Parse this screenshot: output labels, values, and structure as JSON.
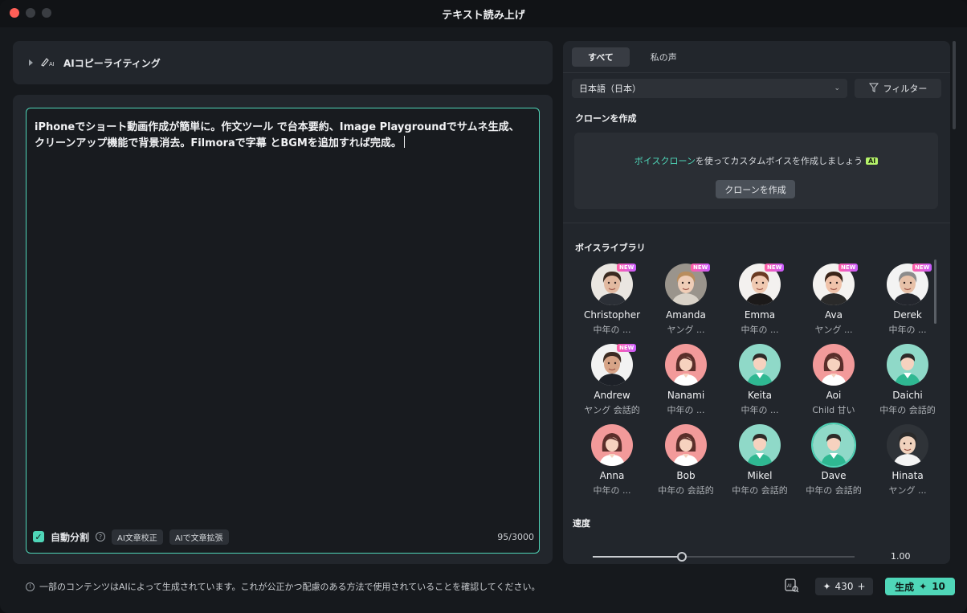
{
  "window": {
    "title": "テキスト読み上げ"
  },
  "copywriting": {
    "label": "AIコピーライティング"
  },
  "editor": {
    "text": "iPhoneでショート動画作成が簡単に。作文ツール で台本要約、Image Playgroundでサムネ生成、 クリーンアップ機能で背景消去。Filmoraで字幕 とBGMを追加すれば完成。",
    "auto_split_label": "自動分割",
    "auto_split_checked": true,
    "chip_proofread": "AI文章校正",
    "chip_expand": "AIで文章拡張",
    "counter": "95/3000"
  },
  "disclaimer": "一部のコンテンツはAIによって生成されています。これが公正かつ配慮のある方法で使用されていることを確認してください。",
  "right_panel": {
    "tabs": [
      {
        "label": "すべて",
        "active": true
      },
      {
        "label": "私の声",
        "active": false
      }
    ],
    "language": "日本語（日本）",
    "filter_label": "フィルター",
    "clone_section_title": "クローンを作成",
    "clone_link": "ボイスクローン",
    "clone_text": "を使ってカスタムボイスを作成しましょう",
    "ai_badge": "AI",
    "clone_button": "クローンを作成",
    "library_title": "ボイスライブラリ",
    "new_badge": "NEW",
    "voices": [
      {
        "name": "Christopher",
        "desc": "中年の ...",
        "new": true,
        "avatar": "photo-male-beard"
      },
      {
        "name": "Amanda",
        "desc": "ヤング ...",
        "new": true,
        "avatar": "photo-female-blonde"
      },
      {
        "name": "Emma",
        "desc": "中年の ...",
        "new": true,
        "avatar": "photo-female-brown"
      },
      {
        "name": "Ava",
        "desc": "ヤング ...",
        "new": true,
        "avatar": "photo-female-dark"
      },
      {
        "name": "Derek",
        "desc": "中年の ...",
        "new": true,
        "avatar": "photo-male-gray"
      },
      {
        "name": "Andrew",
        "desc": "ヤング 会話的",
        "new": true,
        "avatar": "photo-male-headset"
      },
      {
        "name": "Nanami",
        "desc": "中年の ...",
        "new": false,
        "avatar": "female-icon"
      },
      {
        "name": "Keita",
        "desc": "中年の ...",
        "new": false,
        "avatar": "male-icon"
      },
      {
        "name": "Aoi",
        "desc": "Child 甘い",
        "new": false,
        "avatar": "female-icon"
      },
      {
        "name": "Daichi",
        "desc": "中年の 会話的",
        "new": false,
        "avatar": "male-icon"
      },
      {
        "name": "Anna",
        "desc": "中年の ...",
        "new": false,
        "avatar": "female-icon"
      },
      {
        "name": "Bob",
        "desc": "中年の 会話的",
        "new": false,
        "avatar": "female-icon"
      },
      {
        "name": "Mikel",
        "desc": "中年の 会話的",
        "new": false,
        "avatar": "male-icon"
      },
      {
        "name": "Dave",
        "desc": "中年の 会話的",
        "new": false,
        "avatar": "male-icon",
        "selected": true
      },
      {
        "name": "Hinata",
        "desc": "ヤング ...",
        "new": false,
        "avatar": "photo-male-asian"
      }
    ],
    "speed_label": "速度",
    "speed_value": "1.00",
    "speed_fraction": 0.34
  },
  "footer": {
    "credits": "430",
    "generate_label": "生成",
    "generate_cost": "10"
  },
  "colors": {
    "accent": "#4fd6b8",
    "female_bg": "#f29a9a",
    "male_bg": "#8fd9c8"
  }
}
